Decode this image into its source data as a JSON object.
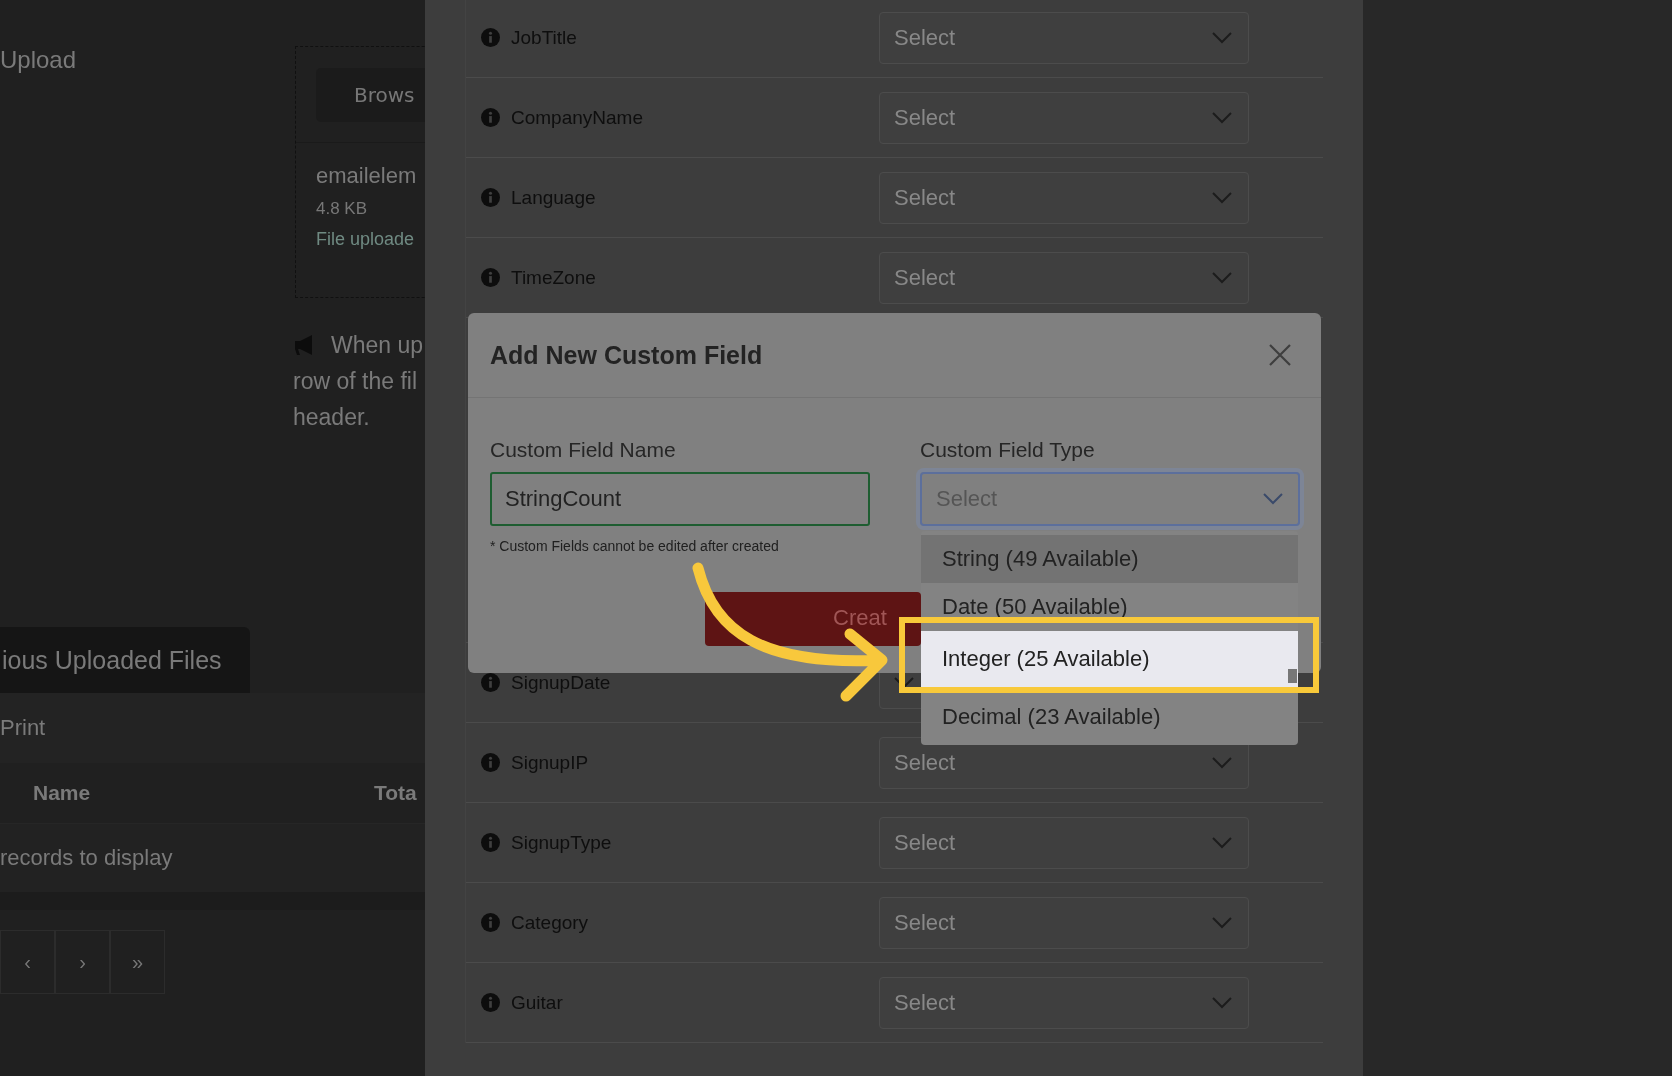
{
  "background_page": {
    "heading": "Upload",
    "browse_button": "Brows",
    "file": {
      "name": "emailelem",
      "size": "4.8 KB",
      "status": "File uploade"
    },
    "note_lines": [
      "When up",
      "row of the fil",
      "header."
    ],
    "tab": "ious Uploaded Files",
    "toolbar": {
      "print": "Print"
    },
    "table": {
      "columns": [
        "Name",
        "Tota"
      ],
      "empty_message": "records to display"
    },
    "pager": [
      "‹",
      "›",
      "»"
    ]
  },
  "mapping_rows_above": [
    {
      "label": "JobTitle",
      "placeholder": "Select"
    },
    {
      "label": "CompanyName",
      "placeholder": "Select"
    },
    {
      "label": "Language",
      "placeholder": "Select"
    },
    {
      "label": "TimeZone",
      "placeholder": "Select"
    }
  ],
  "mapping_rows_below": [
    {
      "label": "SignupDate"
    },
    {
      "label": "SignupIP",
      "placeholder": "Select"
    },
    {
      "label": "SignupType",
      "placeholder": "Select"
    },
    {
      "label": "Category",
      "placeholder": "Select"
    },
    {
      "label": "Guitar",
      "placeholder": "Select"
    }
  ],
  "modal": {
    "title": "Add New Custom Field",
    "name_label": "Custom Field Name",
    "name_value": "StringCount",
    "name_valid": true,
    "type_label": "Custom Field Type",
    "type_placeholder": "Select",
    "type_open": true,
    "hint": "* Custom Fields cannot be edited after created",
    "create_button": "Creat",
    "options": [
      {
        "label": "String (49 Available)",
        "focused": true,
        "selected": false
      },
      {
        "label": "Date (50 Available)",
        "focused": false,
        "selected": false
      },
      {
        "label": "Integer (25 Available)",
        "focused": false,
        "selected": true
      },
      {
        "label": "Decimal (23 Available)",
        "focused": false,
        "selected": false
      }
    ]
  }
}
